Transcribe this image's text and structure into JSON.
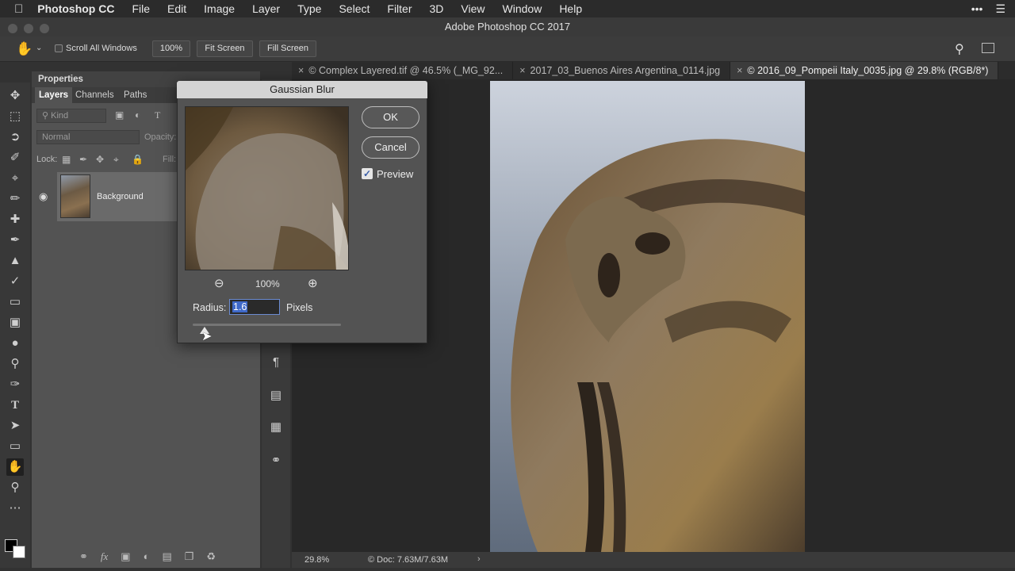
{
  "menubar": {
    "app": "Photoshop CC",
    "items": [
      "File",
      "Edit",
      "Image",
      "Layer",
      "Type",
      "Select",
      "Filter",
      "3D",
      "View",
      "Window",
      "Help"
    ],
    "right": [
      "•••",
      "☰"
    ]
  },
  "window": {
    "title": "Adobe Photoshop CC 2017"
  },
  "options": {
    "scroll_all": "Scroll All Windows",
    "zoom": "100%",
    "fit_screen": "Fit Screen",
    "fill_screen": "Fill Screen"
  },
  "tabs": [
    {
      "label": "© Complex Layered.tif @ 46.5% (_MG_92...",
      "active": false
    },
    {
      "label": "2017_03_Buenos Aires Argentina_0114.jpg",
      "active": false
    },
    {
      "label": "© 2016_09_Pompeii Italy_0035.jpg @ 29.8% (RGB/8*)",
      "active": true
    }
  ],
  "panel": {
    "properties": "Properties",
    "tabs": [
      "Layers",
      "Channels",
      "Paths"
    ],
    "kind_placeholder": "Kind",
    "blend_mode": "Normal",
    "opacity_label": "Opacity:",
    "lock_label": "Lock:",
    "fill_label": "Fill:",
    "layer_name": "Background"
  },
  "status": {
    "zoom": "29.8%",
    "doc": "Doc: 7.63M/7.63M"
  },
  "dialog": {
    "title": "Gaussian Blur",
    "ok": "OK",
    "cancel": "Cancel",
    "preview_label": "Preview",
    "preview_checked": true,
    "zoom": "100%",
    "radius_label": "Radius:",
    "radius_value": "1.6",
    "units": "Pixels",
    "slider_fraction": 0.08
  },
  "icons": {
    "tools": [
      "move-icon",
      "marquee-icon",
      "lasso-icon",
      "quick-select-icon",
      "crop-icon",
      "eyedropper-icon",
      "healing-icon",
      "brush-icon",
      "stamp-icon",
      "history-brush-icon",
      "eraser-icon",
      "gradient-icon",
      "blur-icon",
      "dodge-icon",
      "pen-icon",
      "type-icon",
      "path-select-icon",
      "rectangle-icon",
      "hand-icon",
      "zoom-icon",
      "more-icon"
    ]
  },
  "colors": {
    "accent": "#3f69c9",
    "dialog_bg": "#535353",
    "canvas_bg": "#282828"
  }
}
